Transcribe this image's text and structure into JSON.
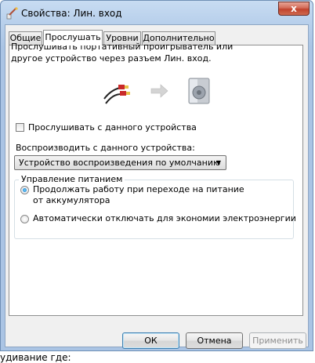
{
  "window": {
    "title": "Свойства: Лин. вход",
    "close_label": "x"
  },
  "tabs": [
    {
      "label": "Общие"
    },
    {
      "label": "Прослушать"
    },
    {
      "label": "Уровни"
    },
    {
      "label": "Дополнительно"
    }
  ],
  "listen": {
    "description": "Прослушивать портативный проигрыватель или другое устройство через разъем Лин. вход.",
    "listen_checkbox_label": "Прослушивать с данного устройства",
    "playback_label": "Воспроизводить с данного устройства:",
    "playback_device": "Устройство воспроизведения по умолчанию"
  },
  "power": {
    "group_title": "Управление питанием",
    "option_continue": "Продолжать работу при переходе на питание от аккумулятора",
    "option_disable": "Автоматически отключать для экономии электроэнергии"
  },
  "buttons": {
    "ok": "ОК",
    "cancel": "Отмена",
    "apply": "Применить"
  },
  "background_text": "удивание где:"
}
